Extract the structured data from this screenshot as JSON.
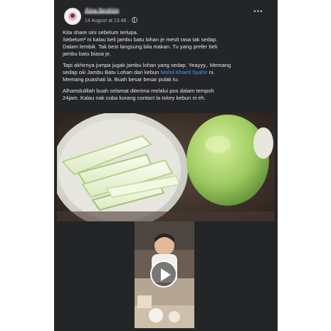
{
  "post": {
    "author": "Aina Ibrahim",
    "timestamp": "14 August at 13:46",
    "separator": "·",
    "privacy_icon": "globe-icon",
    "more_icon": "more-icon",
    "paragraphs": [
      [
        "Kita share sini sebelum terlupa.",
        "Sebelum² ni kalau beli jambu batu lohan je mesti rasa tak sedap.",
        "Dalam lembik. Tak best langsung bila makan. Tu yang prefer beli",
        "jambu batu biasa je."
      ],
      [
        "Tapi akhirnya jumpa jugak jambu lohan yang sedap. Yeayyy,. Memang"
      ],
      [
        "Alhamdulillah buah selamat diterima melalui pos dalam tempoh",
        "24jam. Kalau nak cuba korang contact la tokey kebun ni eh."
      ]
    ],
    "para2_line2_before": "sedap oiii Jambu Batu Lohan dari kebun ",
    "mention": "Mohd Khairil Syahir",
    "para2_line2_after": "  ni.",
    "para2_line3": "Memang puashati la. Buah besar besar pulak tu."
  },
  "media": {
    "photo_subject": "sliced guava in white bowl and whole guava",
    "video_subject": "toddler eating guava",
    "play_icon": "play-icon"
  },
  "colors": {
    "card_bg": "#242526",
    "text": "#e4e6eb",
    "secondary_text": "#b0b3b8",
    "link": "#4599ff"
  }
}
